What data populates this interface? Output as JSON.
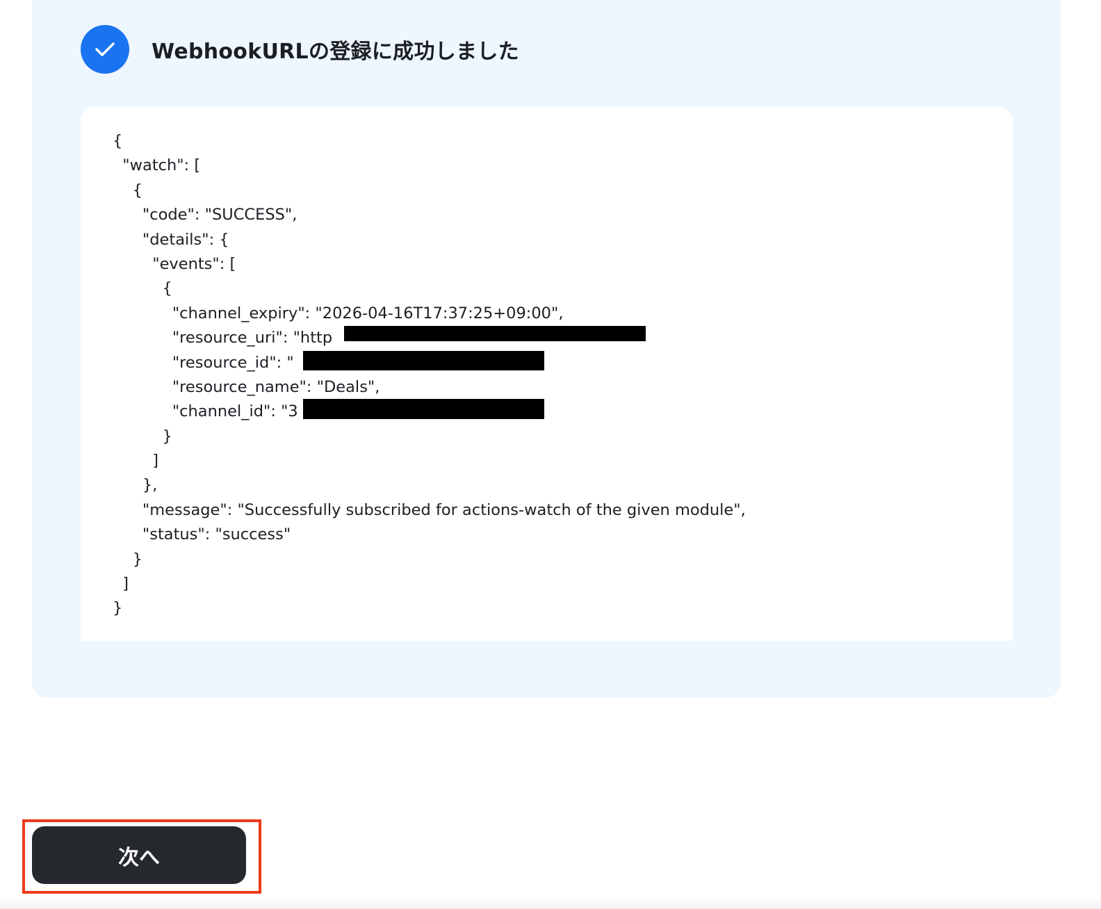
{
  "status": {
    "title": "WebhookURLの登録に成功しました",
    "icon": "check-icon",
    "accent_color": "#1a73f0"
  },
  "response_code": {
    "lines": [
      "{",
      "  \"watch\": [",
      "    {",
      "      \"code\": \"SUCCESS\",",
      "      \"details\": {",
      "        \"events\": [",
      "          {",
      "            \"channel_expiry\": \"2026-04-16T17:37:25+09:00\",",
      "            \"resource_uri\": \"http",
      "            \"resource_id\": \"",
      "            \"resource_name\": \"Deals\",",
      "            \"channel_id\": \"3",
      "          }",
      "        ]",
      "      },",
      "      \"message\": \"Successfully subscribed for actions-watch of the given module\",",
      "      \"status\": \"success\"",
      "    }",
      "  ]",
      "}"
    ]
  },
  "actions": {
    "next_label": "次へ",
    "highlight_color": "#ee3a1a"
  }
}
